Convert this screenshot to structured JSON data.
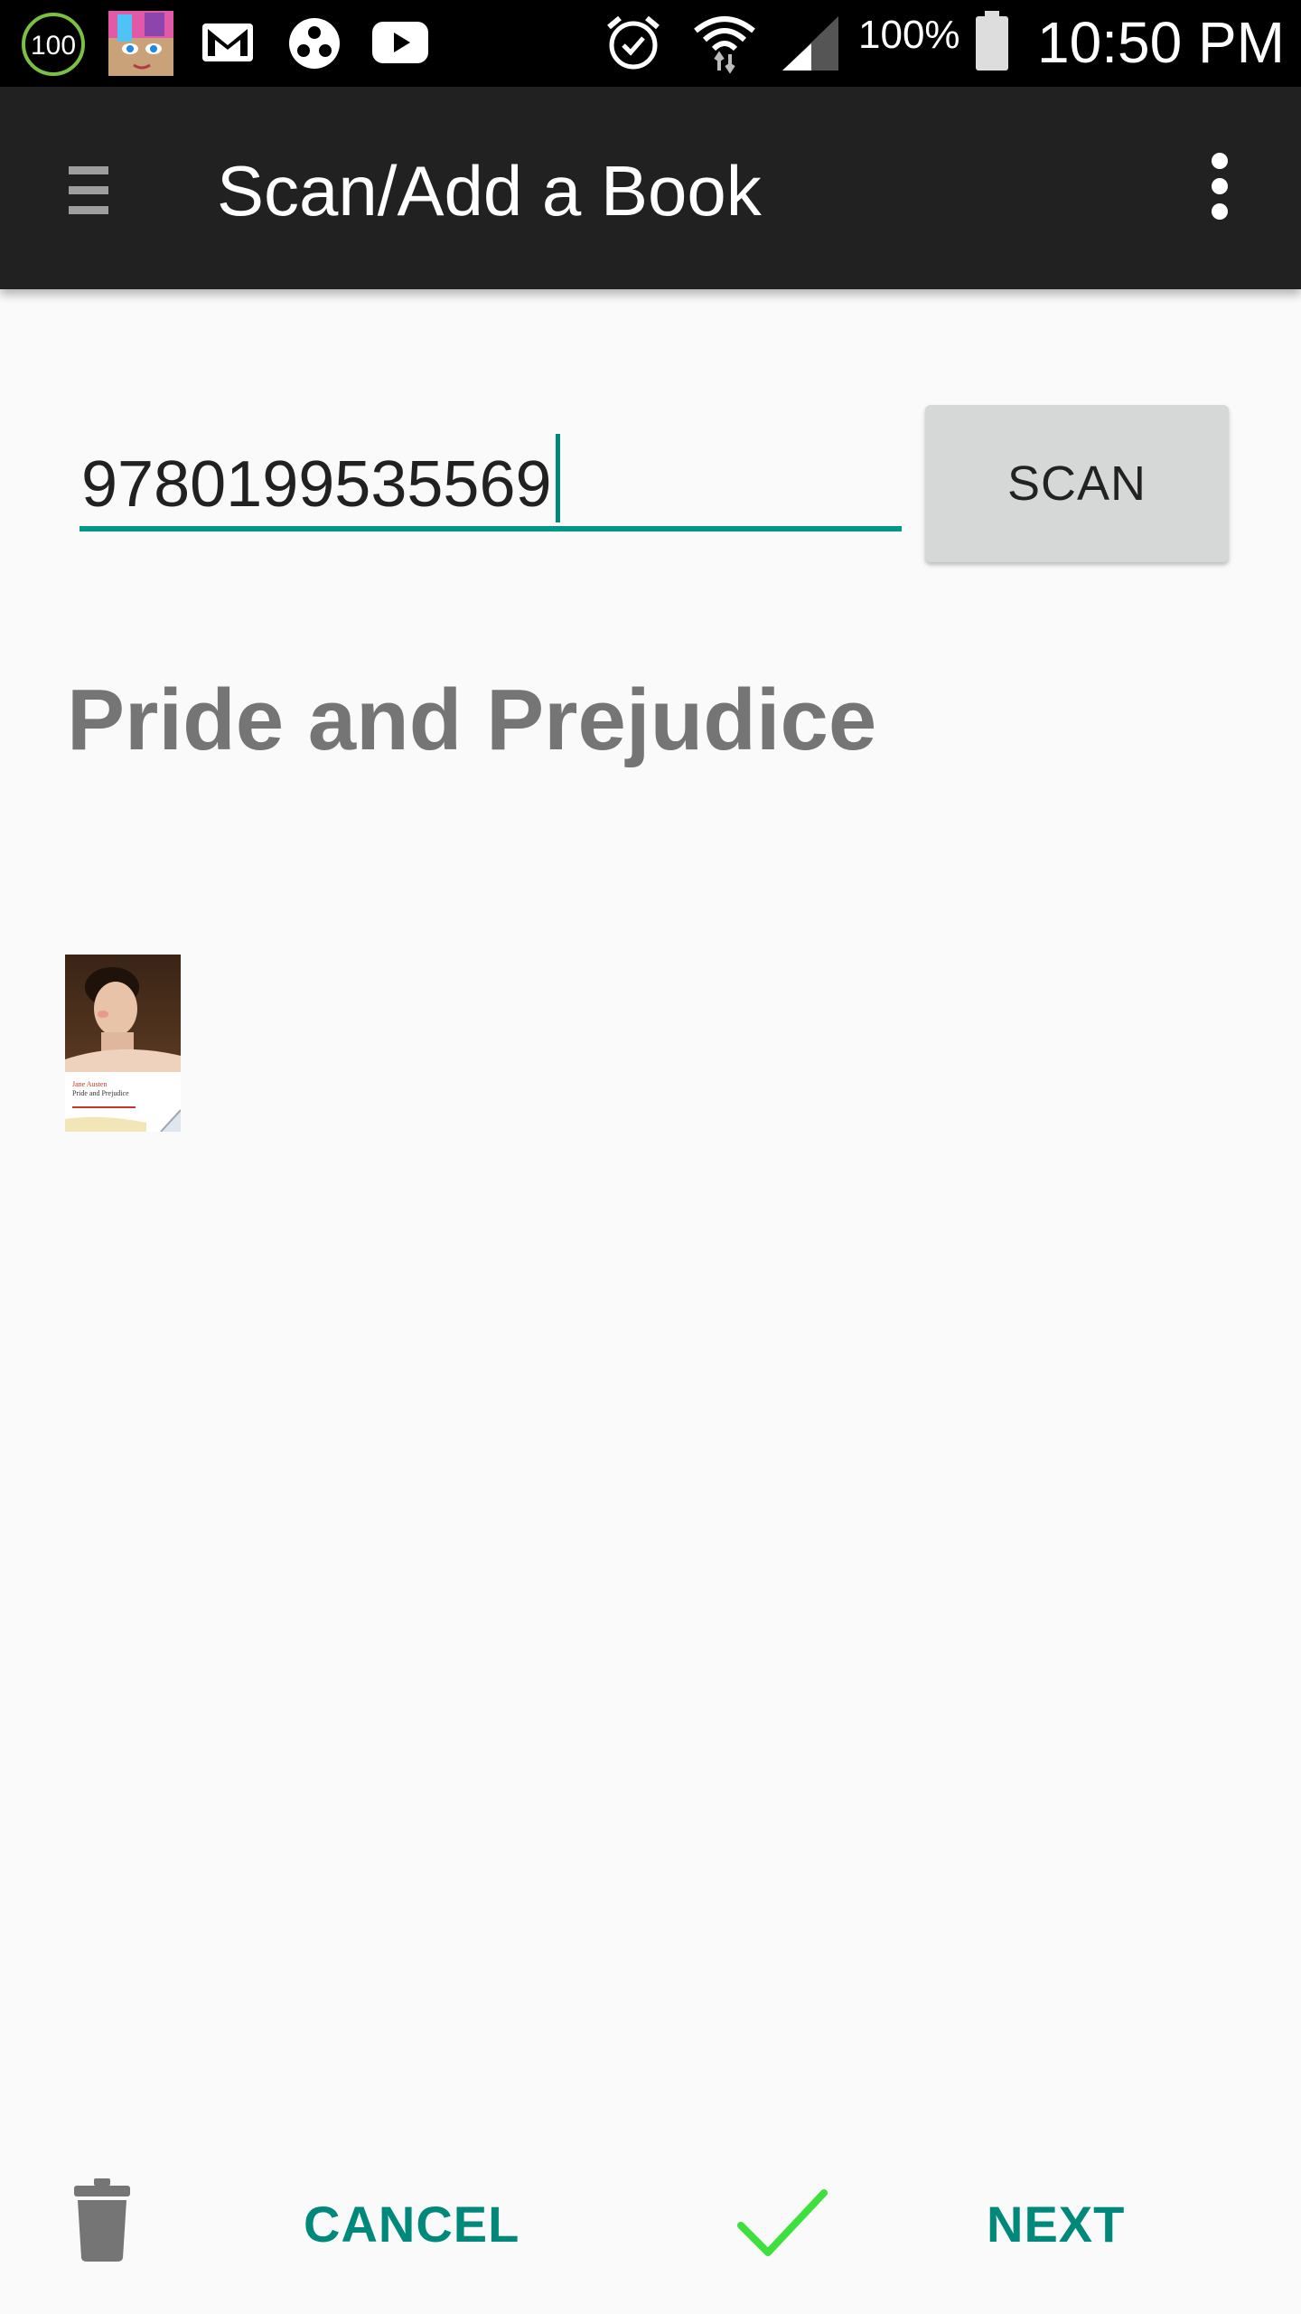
{
  "status_bar": {
    "badge_count": "100",
    "battery_percent": "100%",
    "time": "10:50 PM",
    "icons": [
      "speed-meter-icon",
      "app-avatar-icon",
      "gmail-icon",
      "app-dots-icon",
      "youtube-icon",
      "alarm-icon",
      "wifi-icon",
      "signal-icon",
      "battery-icon"
    ]
  },
  "app_bar": {
    "title": "Scan/Add a Book",
    "menu_icon": "hamburger-menu-icon",
    "overflow_icon": "more-vert-icon"
  },
  "form": {
    "isbn_value": "9780199535569",
    "scan_label": "SCAN"
  },
  "book": {
    "title": "Pride and Prejudice",
    "cover_author": "Jane Austen",
    "cover_title": "Pride and Prejudice"
  },
  "bottom_bar": {
    "delete_icon": "trash-icon",
    "cancel_label": "CANCEL",
    "confirm_icon": "check-icon",
    "next_label": "NEXT"
  },
  "colors": {
    "app_bar": "#212121",
    "accent": "#009688",
    "check": "#3ee03e",
    "background": "#fafafa"
  }
}
